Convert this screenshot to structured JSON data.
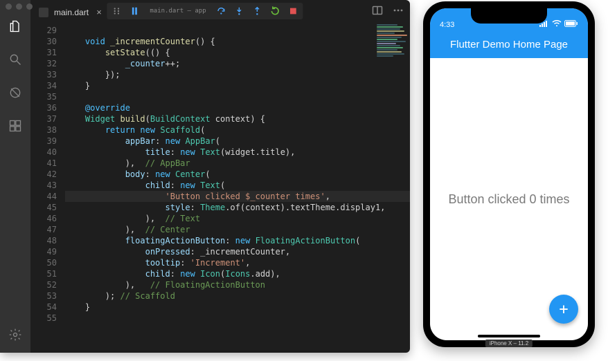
{
  "editor": {
    "tab": {
      "filename": "main.dart"
    },
    "debug_label": "main.dart — app",
    "line_start": 29,
    "lines": [
      [],
      [
        [
          "kw",
          "void"
        ],
        [
          "plain",
          " "
        ],
        [
          "fn",
          "_incrementCounter"
        ],
        [
          "plain",
          "() {"
        ]
      ],
      [
        [
          "plain",
          "  "
        ],
        [
          "fn",
          "setState"
        ],
        [
          "plain",
          "(() {"
        ]
      ],
      [
        [
          "plain",
          "    "
        ],
        [
          "prop",
          "_counter"
        ],
        [
          "plain",
          "++;"
        ]
      ],
      [
        [
          "plain",
          "  });"
        ]
      ],
      [
        [
          "plain",
          "}"
        ]
      ],
      [],
      [
        [
          "kw",
          "@override"
        ]
      ],
      [
        [
          "type",
          "Widget"
        ],
        [
          "plain",
          " "
        ],
        [
          "fn",
          "build"
        ],
        [
          "plain",
          "("
        ],
        [
          "type",
          "BuildContext"
        ],
        [
          "plain",
          " context) {"
        ]
      ],
      [
        [
          "plain",
          "  "
        ],
        [
          "kw",
          "return"
        ],
        [
          "plain",
          " "
        ],
        [
          "kw",
          "new"
        ],
        [
          "plain",
          " "
        ],
        [
          "type",
          "Scaffold"
        ],
        [
          "plain",
          "("
        ]
      ],
      [
        [
          "plain",
          "    "
        ],
        [
          "prop",
          "appBar"
        ],
        [
          "plain",
          ": "
        ],
        [
          "kw",
          "new"
        ],
        [
          "plain",
          " "
        ],
        [
          "type",
          "AppBar"
        ],
        [
          "plain",
          "("
        ]
      ],
      [
        [
          "plain",
          "      "
        ],
        [
          "prop",
          "title"
        ],
        [
          "plain",
          ": "
        ],
        [
          "kw",
          "new"
        ],
        [
          "plain",
          " "
        ],
        [
          "type",
          "Text"
        ],
        [
          "plain",
          "(widget.title),"
        ]
      ],
      [
        [
          "plain",
          "    ),  "
        ],
        [
          "cmt",
          "// AppBar"
        ]
      ],
      [
        [
          "plain",
          "    "
        ],
        [
          "prop",
          "body"
        ],
        [
          "plain",
          ": "
        ],
        [
          "kw",
          "new"
        ],
        [
          "plain",
          " "
        ],
        [
          "type",
          "Center"
        ],
        [
          "plain",
          "("
        ]
      ],
      [
        [
          "plain",
          "      "
        ],
        [
          "prop",
          "child"
        ],
        [
          "plain",
          ": "
        ],
        [
          "kw",
          "new"
        ],
        [
          "plain",
          " "
        ],
        [
          "type",
          "Text"
        ],
        [
          "plain",
          "("
        ]
      ],
      [
        [
          "plain",
          "        "
        ],
        [
          "str",
          "'Button clicked $_counter times'"
        ],
        [
          "plain",
          ","
        ]
      ],
      [
        [
          "plain",
          "        "
        ],
        [
          "prop",
          "style"
        ],
        [
          "plain",
          ": "
        ],
        [
          "type",
          "Theme"
        ],
        [
          "plain",
          ".of(context).textTheme.display1,"
        ]
      ],
      [
        [
          "plain",
          "      ),  "
        ],
        [
          "cmt",
          "// Text"
        ]
      ],
      [
        [
          "plain",
          "    ),  "
        ],
        [
          "cmt",
          "// Center"
        ]
      ],
      [
        [
          "plain",
          "    "
        ],
        [
          "prop",
          "floatingActionButton"
        ],
        [
          "plain",
          ": "
        ],
        [
          "kw",
          "new"
        ],
        [
          "plain",
          " "
        ],
        [
          "type",
          "FloatingActionButton"
        ],
        [
          "plain",
          "("
        ]
      ],
      [
        [
          "plain",
          "      "
        ],
        [
          "prop",
          "onPressed"
        ],
        [
          "plain",
          ": _incrementCounter,"
        ]
      ],
      [
        [
          "plain",
          "      "
        ],
        [
          "prop",
          "tooltip"
        ],
        [
          "plain",
          ": "
        ],
        [
          "str",
          "'Increment'"
        ],
        [
          "plain",
          ","
        ]
      ],
      [
        [
          "plain",
          "      "
        ],
        [
          "prop",
          "child"
        ],
        [
          "plain",
          ": "
        ],
        [
          "kw",
          "new"
        ],
        [
          "plain",
          " "
        ],
        [
          "type",
          "Icon"
        ],
        [
          "plain",
          "("
        ],
        [
          "type",
          "Icons"
        ],
        [
          "plain",
          ".add),"
        ]
      ],
      [
        [
          "plain",
          "    ),   "
        ],
        [
          "cmt",
          "// FloatingActionButton"
        ]
      ],
      [
        [
          "plain",
          "  ); "
        ],
        [
          "cmt",
          "// Scaffold"
        ]
      ],
      [
        [
          "plain",
          "}"
        ]
      ],
      []
    ],
    "line_indents": [
      2,
      2,
      3,
      4,
      3,
      2,
      0,
      2,
      2,
      3,
      4,
      5,
      4,
      4,
      5,
      6,
      6,
      5,
      4,
      4,
      5,
      5,
      5,
      4,
      3,
      2,
      2
    ],
    "highlighted_line_index": 15
  },
  "simulator": {
    "status_time": "4:33",
    "appbar_title": "Flutter Demo Home Page",
    "body_text": "Button clicked 0 times",
    "device_label": "iPhone X – 11.2"
  }
}
